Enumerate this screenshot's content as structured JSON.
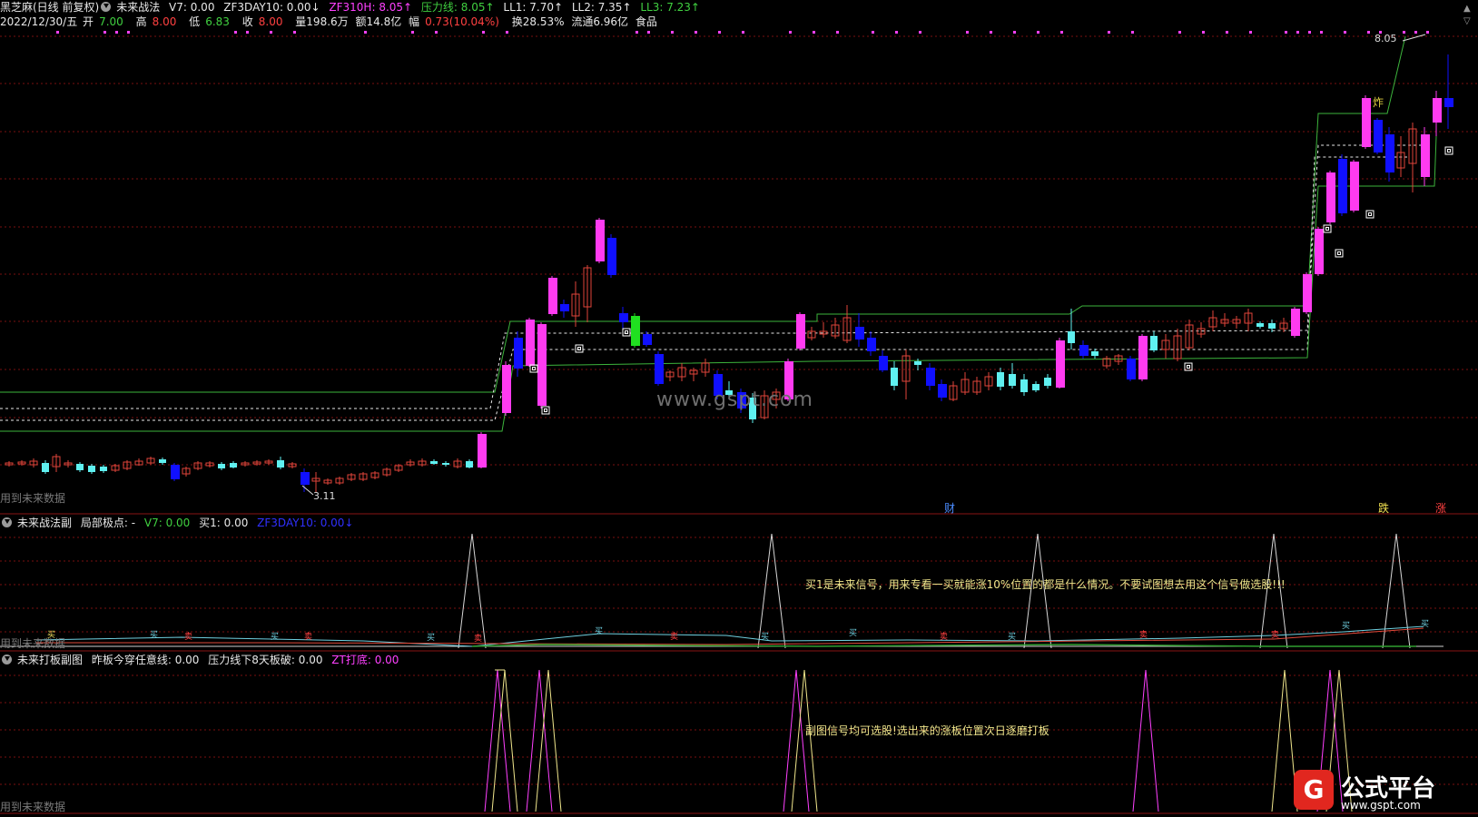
{
  "header": {
    "stock_name": "黑芝麻(日线 前复权)",
    "indicator": "未来战法",
    "v7": "V7: 0.00",
    "zf3day10": "ZF3DAY10: 0.00↓",
    "zf310h": "ZF310H: 8.05↑",
    "pressure": "压力线: 8.05↑",
    "ll1": "LL1: 7.70↑",
    "ll2": "LL2: 7.35↑",
    "ll3": "LL3: 7.23↑"
  },
  "quote": {
    "date": "2022/12/30/五",
    "open_label": "开",
    "open": "7.00",
    "high_label": "高",
    "high": "8.00",
    "low_label": "低",
    "low": "6.83",
    "close_label": "收",
    "close": "8.00",
    "volume": "量198.6万",
    "amount": "额14.8亿",
    "change_label": "幅",
    "change": "0.73(10.04%)",
    "turnover": "换28.53%",
    "float": "流通6.96亿",
    "sector": "食品"
  },
  "panel1": {
    "label_bottom": "用到未来数据",
    "price_high_label": "8.05",
    "price_low_label": "3.11",
    "watermark": "www.gspt.com",
    "markers": [
      "财",
      "跌",
      "涨"
    ],
    "signal_zha": "炸"
  },
  "panel2": {
    "title": "未来战法副",
    "sub": "局部极点: -",
    "v7": "V7: 0.00",
    "buy1": "买1: 0.00",
    "zf3day10": "ZF3DAY10: 0.00↓",
    "note": "买1是未来信号，用来专看一买就能涨10%位置的都是什么情况。不要试图想去用这个信号做选股!!!",
    "label_bottom": "用到未来数据",
    "buy_tag": "买",
    "sell_tag": "卖"
  },
  "panel3": {
    "title": "未来打板副图",
    "line1": "昨板今穿任意线: 0.00",
    "line2": "压力线下8天板破: 0.00",
    "line3": "ZT打底: 0.00",
    "note": "副图信号均可选股!选出来的涨板位置次日逐磨打板",
    "label_bottom": "用到未来数据"
  },
  "logo": {
    "text": "公式平台",
    "url": "www.gspt.com"
  },
  "colors": {
    "up": "#ff3bf0",
    "down": "#1010ff",
    "small_up": "#e0453a",
    "small_down": "#5ff0f0",
    "grid": "#7a1010",
    "green_line": "#3cb43c"
  }
}
